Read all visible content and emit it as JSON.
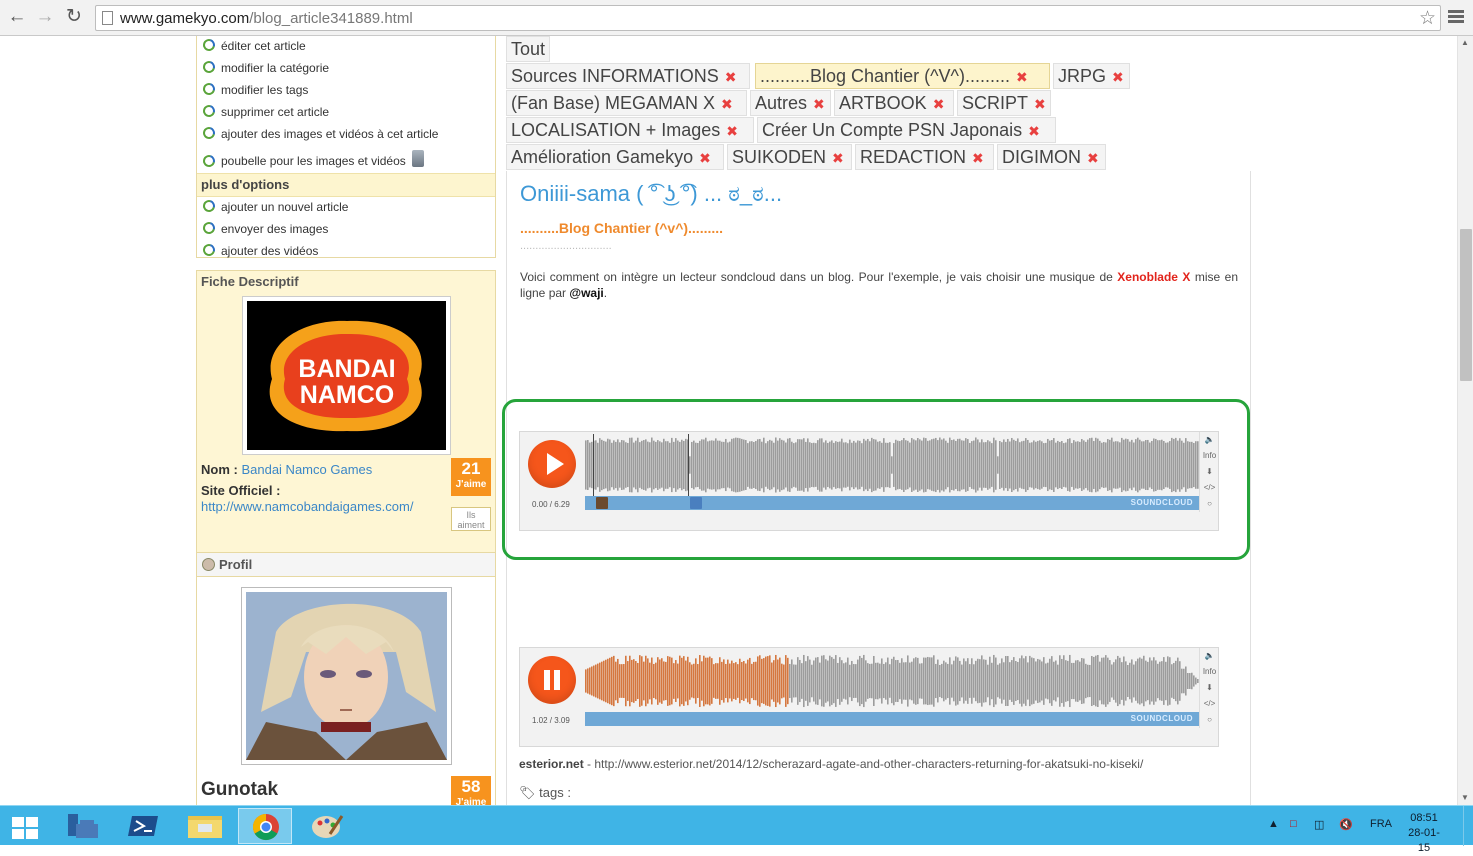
{
  "browser": {
    "url_host": "www.gamekyo.com",
    "url_path": "/blog_article341889.html"
  },
  "sidebar": {
    "menu_items": [
      "éditer cet article",
      "modifier la catégorie",
      "modifier les tags",
      "supprimer cet article",
      "ajouter des images et vidéos à cet article",
      "poubelle pour les images et vidéos"
    ],
    "more_options_title": "plus d'options",
    "more_items": [
      "ajouter un nouvel article",
      "envoyer des images",
      "ajouter des vidéos"
    ],
    "fiche": {
      "title": "Fiche Descriptif",
      "logo_line1": "BANDAI",
      "logo_line2": "NAMCO",
      "nom_label": "Nom :",
      "nom_value": "Bandai Namco Games",
      "site_label": "Site Officiel :",
      "site_value": "http://www.namcobandaigames.com/",
      "likes": "21",
      "likes_label": "J'aime",
      "likes_sub": "Ils aiment"
    },
    "profil": {
      "title": "Profil",
      "username": "Gunotak",
      "likes": "58",
      "likes_label": "J'aime"
    }
  },
  "tags": [
    {
      "label": "Tout",
      "removable": false
    },
    {
      "label": "Sources INFORMATIONS",
      "removable": true
    },
    {
      "label": "..........Blog Chantier (^V^).........",
      "removable": true,
      "active": true
    },
    {
      "label": "JRPG",
      "removable": true
    },
    {
      "label": "(Fan Base) MEGAMAN X",
      "removable": true
    },
    {
      "label": "Autres",
      "removable": true
    },
    {
      "label": "ARTBOOK",
      "removable": true
    },
    {
      "label": "SCRIPT",
      "removable": true
    },
    {
      "label": "LOCALISATION + Images",
      "removable": true
    },
    {
      "label": "Créer Un Compte PSN Japonais",
      "removable": true
    },
    {
      "label": "Amélioration Gamekyo",
      "removable": true
    },
    {
      "label": "SUIKODEN",
      "removable": true
    },
    {
      "label": "REDACTION",
      "removable": true
    },
    {
      "label": "DIGIMON",
      "removable": true
    }
  ],
  "tag_remove_glyph": "✖",
  "article": {
    "title": "Oniiii-sama ( ͡° ͜ʖ ͡°) ... ಠ_ಠ...",
    "blog": "..........Blog Chantier (^v^).........",
    "dots": "..............................",
    "text_before": "Voici comment on intègre un lecteur sondcloud dans un blog. Pour l'exemple, je vais choisir une musique de ",
    "text_red": "Xenoblade X",
    "text_middle": " mise en ligne par ",
    "text_user": "@waji",
    "text_after": "."
  },
  "player1": {
    "time": "0.00 / 6.29",
    "progress": 0.0,
    "brand": "SOUNDCLOUD",
    "info": "Info",
    "embed": "</>"
  },
  "player2": {
    "time": "1.02 / 3.09",
    "progress": 0.33,
    "brand": "SOUNDCLOUD",
    "info": "Info",
    "embed": "</>"
  },
  "source": {
    "name": "esterior.net",
    "sep": " - ",
    "url": "http://www.esterior.net/2014/12/scherazard-agate-and-other-characters-returning-for-akatsuki-no-kiseki/"
  },
  "tags_label": "tags :",
  "taskbar": {
    "lang": "FRA",
    "time": "08:51",
    "date": "28-01-15"
  },
  "colors": {
    "accent_orange": "#f5561b",
    "link_blue": "#3d98d6",
    "highlight_green": "#26a43b",
    "taskbar": "#3fb4e6"
  }
}
